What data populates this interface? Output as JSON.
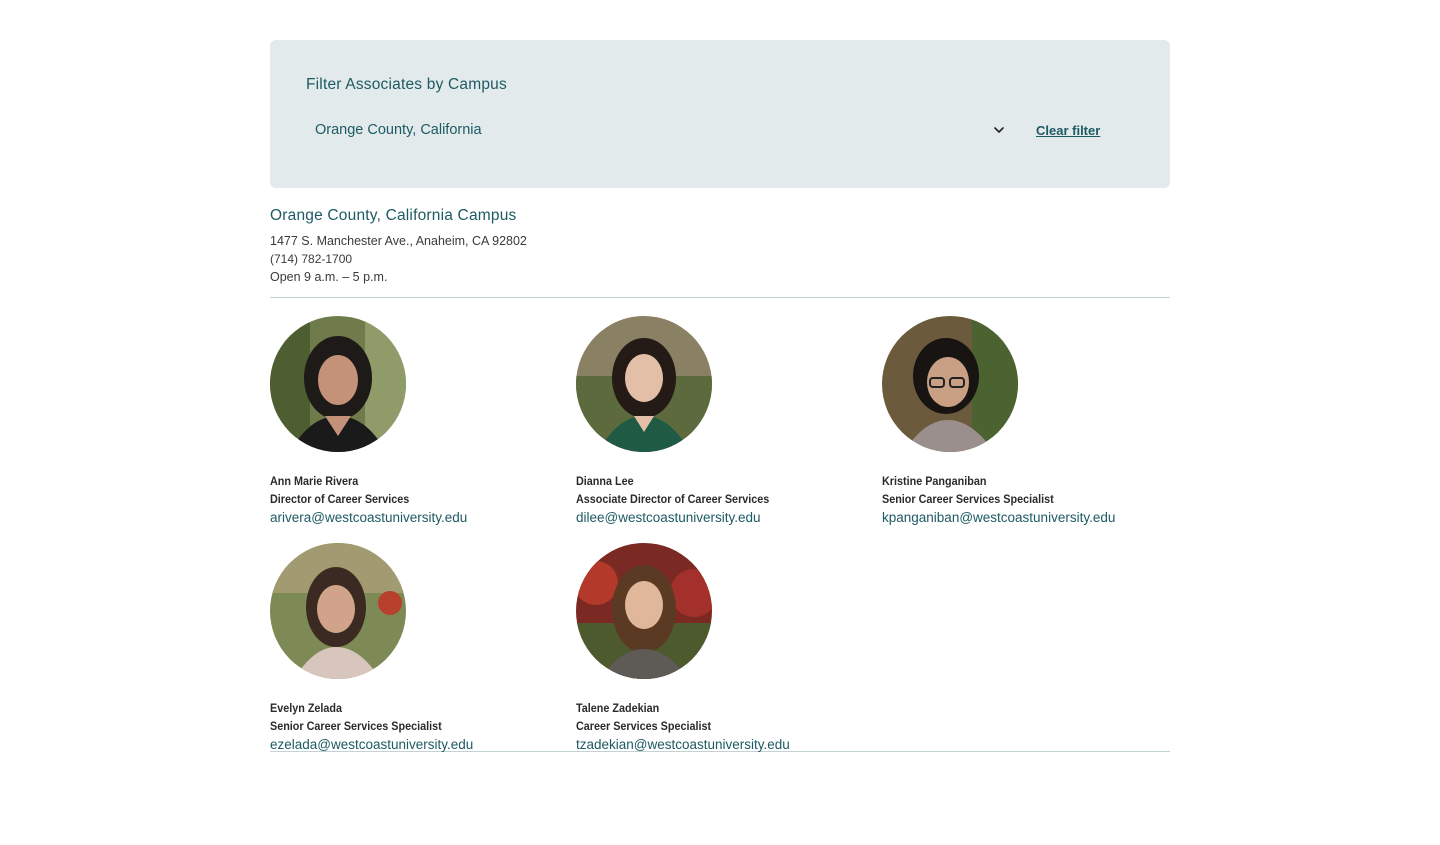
{
  "filter": {
    "title": "Filter Associates by Campus",
    "selected_campus": "Orange County, California",
    "clear_label": "Clear filter"
  },
  "campus": {
    "name": "Orange County, California Campus",
    "address": "1477 S. Manchester Ave., Anaheim, CA 92802",
    "phone": "(714) 782-1700",
    "hours": "Open 9 a.m. – 5 p.m."
  },
  "associates": [
    {
      "name": "Ann Marie Rivera",
      "title": "Director of Career Services",
      "email": "arivera@westcoastuniversity.edu"
    },
    {
      "name": "Dianna Lee",
      "title": "Associate Director of Career Services",
      "email": "dilee@westcoastuniversity.edu"
    },
    {
      "name": "Kristine Panganiban",
      "title": "Senior Career Services Specialist",
      "email": "kpanganiban@westcoastuniversity.edu"
    },
    {
      "name": "Evelyn Zelada",
      "title": "Senior Career Services Specialist",
      "email": "ezelada@westcoastuniversity.edu"
    },
    {
      "name": "Talene Zadekian",
      "title": "Career Services Specialist",
      "email": "tzadekian@westcoastuniversity.edu"
    }
  ],
  "colors": {
    "accent": "#1d5a63",
    "panel_bg": "#e3eaec",
    "divider": "#c3d3d5"
  },
  "icons": {
    "select_chevron": "chevron-down-icon"
  }
}
